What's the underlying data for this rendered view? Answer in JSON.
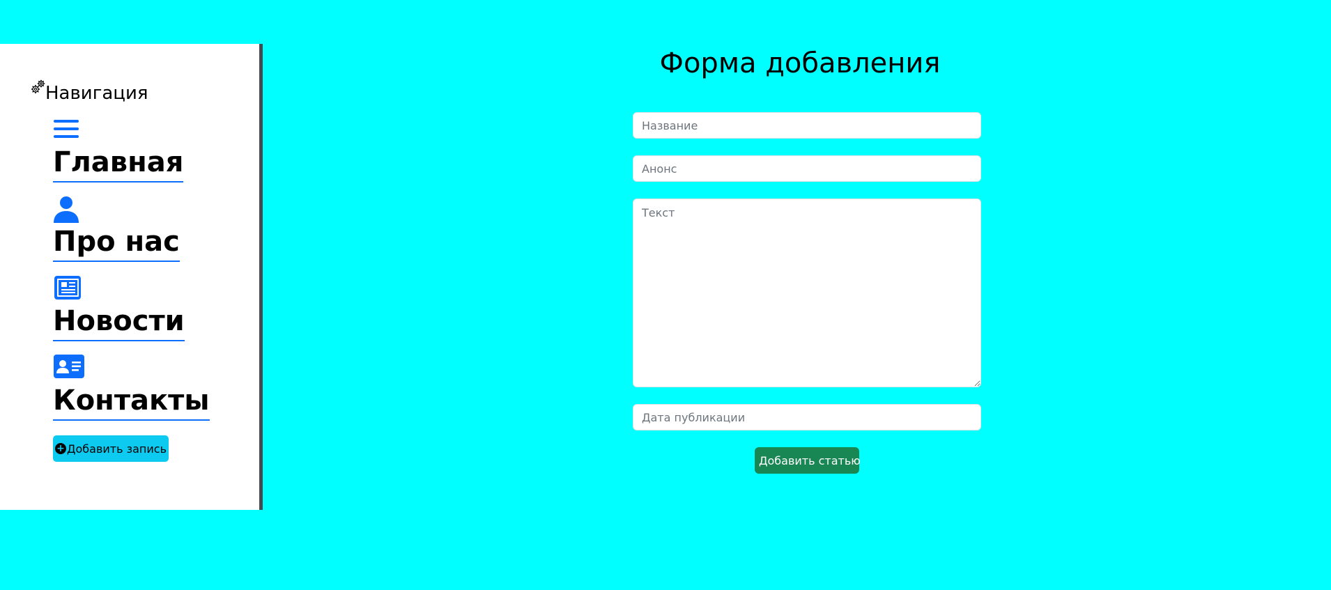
{
  "sidebar": {
    "heading": "Навигация",
    "heading_icon": "gears-icon",
    "items": [
      {
        "label": "Главная",
        "icon": "hamburger-icon"
      },
      {
        "label": "Про нас",
        "icon": "person-icon"
      },
      {
        "label": "Новости",
        "icon": "newspaper-icon"
      },
      {
        "label": "Контакты",
        "icon": "person-vcard-icon"
      }
    ],
    "add_button": {
      "label": "Добавить запись",
      "icon": "plus-circle-icon"
    }
  },
  "form": {
    "title": "Форма добавления",
    "fields": {
      "title_placeholder": "Название",
      "announce_placeholder": "Анонс",
      "text_placeholder": "Текст",
      "date_placeholder": "Дата публикации"
    },
    "submit_label": "Добавить статью"
  },
  "colors": {
    "background": "#00ffff",
    "sidebar_bg": "#ffffff",
    "sidebar_border": "#444a50",
    "icon_blue": "#0d6efd",
    "info_button": "#0dcaf0",
    "success_button": "#198754"
  }
}
